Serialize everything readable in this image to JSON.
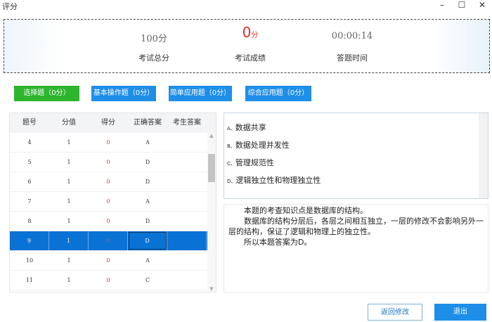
{
  "window": {
    "title": "评分",
    "minimize": "–",
    "maximize": "☐",
    "close": "✕"
  },
  "summary": {
    "total_value": "100分",
    "total_label": "考试总分",
    "score_value": "0",
    "score_unit": "分",
    "score_label": "考试成绩",
    "time_value": "00:00:14",
    "time_label": "答题时间"
  },
  "tabs": [
    {
      "label": "选择题（0分）"
    },
    {
      "label": "基本操作题（0分）"
    },
    {
      "label": "简单应用题（0分）"
    },
    {
      "label": "综合应用题（0分）"
    }
  ],
  "table": {
    "headers": [
      "题号",
      "分值",
      "得分",
      "正确答案",
      "考生答案"
    ],
    "rows": [
      [
        "4",
        "1",
        "0",
        "A",
        ""
      ],
      [
        "5",
        "1",
        "0",
        "D",
        ""
      ],
      [
        "6",
        "1",
        "0",
        "D",
        ""
      ],
      [
        "7",
        "1",
        "0",
        "A",
        ""
      ],
      [
        "8",
        "1",
        "0",
        "D",
        ""
      ],
      [
        "9",
        "1",
        "0",
        "D",
        ""
      ],
      [
        "10",
        "1",
        "0",
        "A",
        ""
      ],
      [
        "11",
        "1",
        "0",
        "C",
        ""
      ]
    ],
    "selected_index": 5
  },
  "options": [
    {
      "key": "A、",
      "text": "数据共享"
    },
    {
      "key": "B、",
      "text": "数据处理并发性"
    },
    {
      "key": "C、",
      "text": "管理规范性"
    },
    {
      "key": "D、",
      "text": "逻辑独立性和物理独立性"
    }
  ],
  "explanation": [
    "本题的考查知识点是数据库的结构。",
    "数据库的结构分层后，各层之间相互独立，一层的修改不会影响另外一层的结构，保证了逻辑和物理上的独立性。",
    "所以本题答案为D。"
  ],
  "buttons": {
    "back": "返回修改",
    "exit": "退出"
  }
}
